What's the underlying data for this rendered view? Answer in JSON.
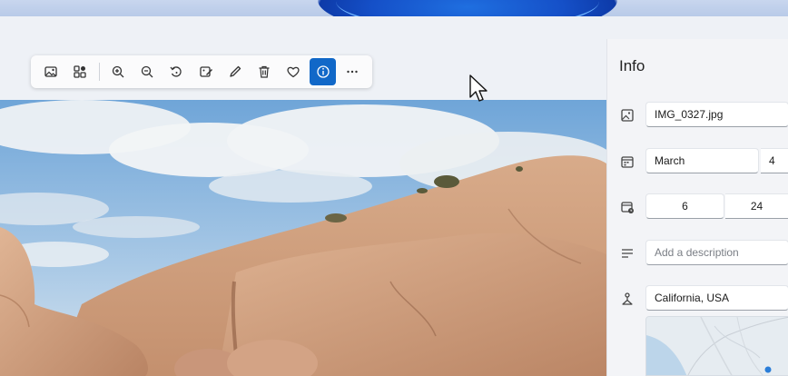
{
  "toolbar": {
    "items": [
      {
        "name": "photo-icon"
      },
      {
        "name": "collection-icon"
      },
      {
        "name": "zoom-in-icon"
      },
      {
        "name": "zoom-out-icon"
      },
      {
        "name": "rotate-icon"
      },
      {
        "name": "edit-image-icon"
      },
      {
        "name": "draw-icon"
      },
      {
        "name": "delete-icon"
      },
      {
        "name": "favorite-icon"
      },
      {
        "name": "info-icon",
        "active": true
      },
      {
        "name": "more-icon"
      }
    ],
    "accent": "#1168c8"
  },
  "info": {
    "title": "Info",
    "file_name": "IMG_0327.jpg",
    "date_month": "March",
    "date_day": "4",
    "time_hour": "6",
    "time_minute": "24",
    "description_placeholder": "Add a description",
    "location": "California, USA"
  }
}
